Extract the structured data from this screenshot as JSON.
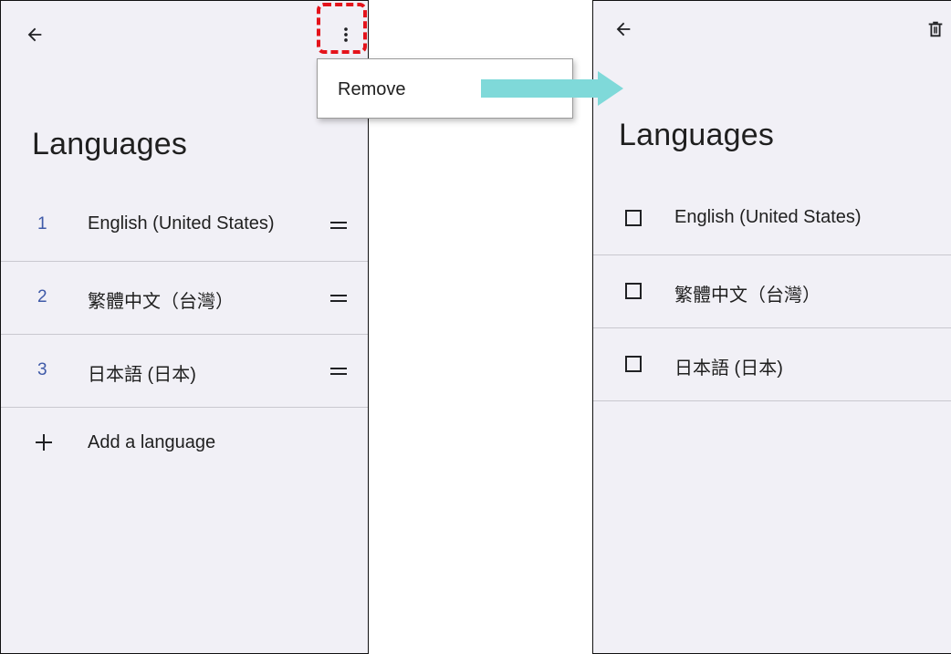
{
  "left_screen": {
    "title": "Languages",
    "languages": [
      {
        "number": "1",
        "label": "English (United States)"
      },
      {
        "number": "2",
        "label": "繁體中文（台灣）"
      },
      {
        "number": "3",
        "label": "日本語 (日本)"
      }
    ],
    "add_language_label": "Add a language",
    "overflow_menu": {
      "items": [
        {
          "label": "Remove"
        }
      ]
    }
  },
  "right_screen": {
    "title": "Languages",
    "languages": [
      {
        "label": "English (United States)",
        "checked": false
      },
      {
        "label": "繁體中文（台灣）",
        "checked": false
      },
      {
        "label": "日本語 (日本)",
        "checked": false
      }
    ]
  },
  "colors": {
    "screen_background": "#f1f0f6",
    "number_accent": "#3f5aa8",
    "highlight_red": "#e4131b",
    "arrow_teal": "#7fd9d9"
  },
  "icons": {
    "back": "arrow-left-icon",
    "overflow": "more-vert-icon",
    "drag": "drag-handle-icon",
    "add": "plus-icon",
    "delete": "trash-icon",
    "checkbox": "checkbox-outline-icon"
  }
}
